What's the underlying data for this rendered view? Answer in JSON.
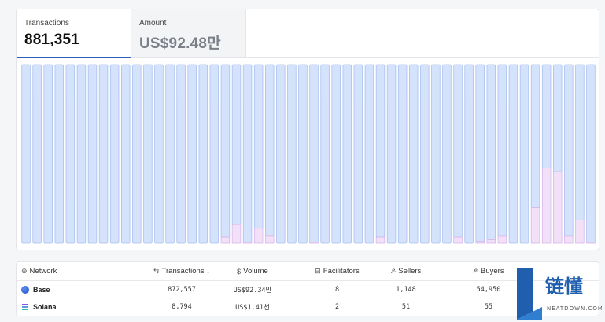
{
  "tabs": [
    {
      "label": "Transactions",
      "value": "881,351"
    },
    {
      "label": "Amount",
      "value": "US$92.48만"
    }
  ],
  "chart_data": {
    "type": "bar",
    "stacked": true,
    "ylim": [
      0,
      100
    ],
    "series_colors": {
      "background": "#d4e2fb",
      "highlight": "#f1e0f8"
    },
    "background_values": [
      100,
      100,
      100,
      100,
      100,
      100,
      100,
      100,
      100,
      100,
      100,
      100,
      100,
      100,
      100,
      100,
      100,
      100,
      100,
      100,
      100,
      100,
      100,
      100,
      100,
      100,
      100,
      100,
      100,
      100,
      100,
      100,
      100,
      100,
      100,
      100,
      100,
      100,
      100,
      100,
      100,
      100,
      100,
      100,
      100,
      100,
      100,
      100,
      100
    ],
    "highlight_values": [
      0,
      0,
      0,
      0,
      0,
      0,
      0,
      0,
      0,
      0,
      0,
      0,
      0,
      0,
      0,
      0,
      0,
      0,
      3.5,
      10.5,
      0.5,
      8.5,
      4,
      0,
      0,
      0,
      0.5,
      0,
      0,
      0,
      0,
      0,
      3.5,
      0,
      0,
      0,
      0,
      0,
      0,
      3.5,
      0,
      1,
      2,
      4,
      0,
      0,
      20,
      42,
      40,
      4,
      13,
      0.5
    ]
  },
  "table": {
    "headers": [
      {
        "icon": "globe-icon",
        "glyph": "⊕",
        "label": "Network"
      },
      {
        "icon": "swap-icon",
        "glyph": "⇆",
        "label": "Transactions ↓"
      },
      {
        "icon": "dollar-icon",
        "glyph": "$",
        "label": "Volume"
      },
      {
        "icon": "server-icon",
        "glyph": "⊟",
        "label": "Facilitators"
      },
      {
        "icon": "user-icon",
        "glyph": "ዶ",
        "label": "Sellers"
      },
      {
        "icon": "user-icon",
        "glyph": "ዶ",
        "label": "Buyers"
      }
    ],
    "rows": [
      {
        "network": "Base",
        "icon": "base-logo-icon",
        "color": "#2f62e0",
        "transactions": "872,557",
        "volume": "US$92.34만",
        "facilitators": "8",
        "sellers": "1,148",
        "buyers": "54,950"
      },
      {
        "network": "Solana",
        "icon": "solana-logo-icon",
        "color": "#6b57d6",
        "transactions": "8,794",
        "volume": "US$1.41천",
        "facilitators": "2",
        "sellers": "51",
        "buyers": "55"
      }
    ]
  },
  "watermark": {
    "brand": "链懂",
    "sub": "NEATDOWN.COM",
    "color": "#1f5fae"
  }
}
